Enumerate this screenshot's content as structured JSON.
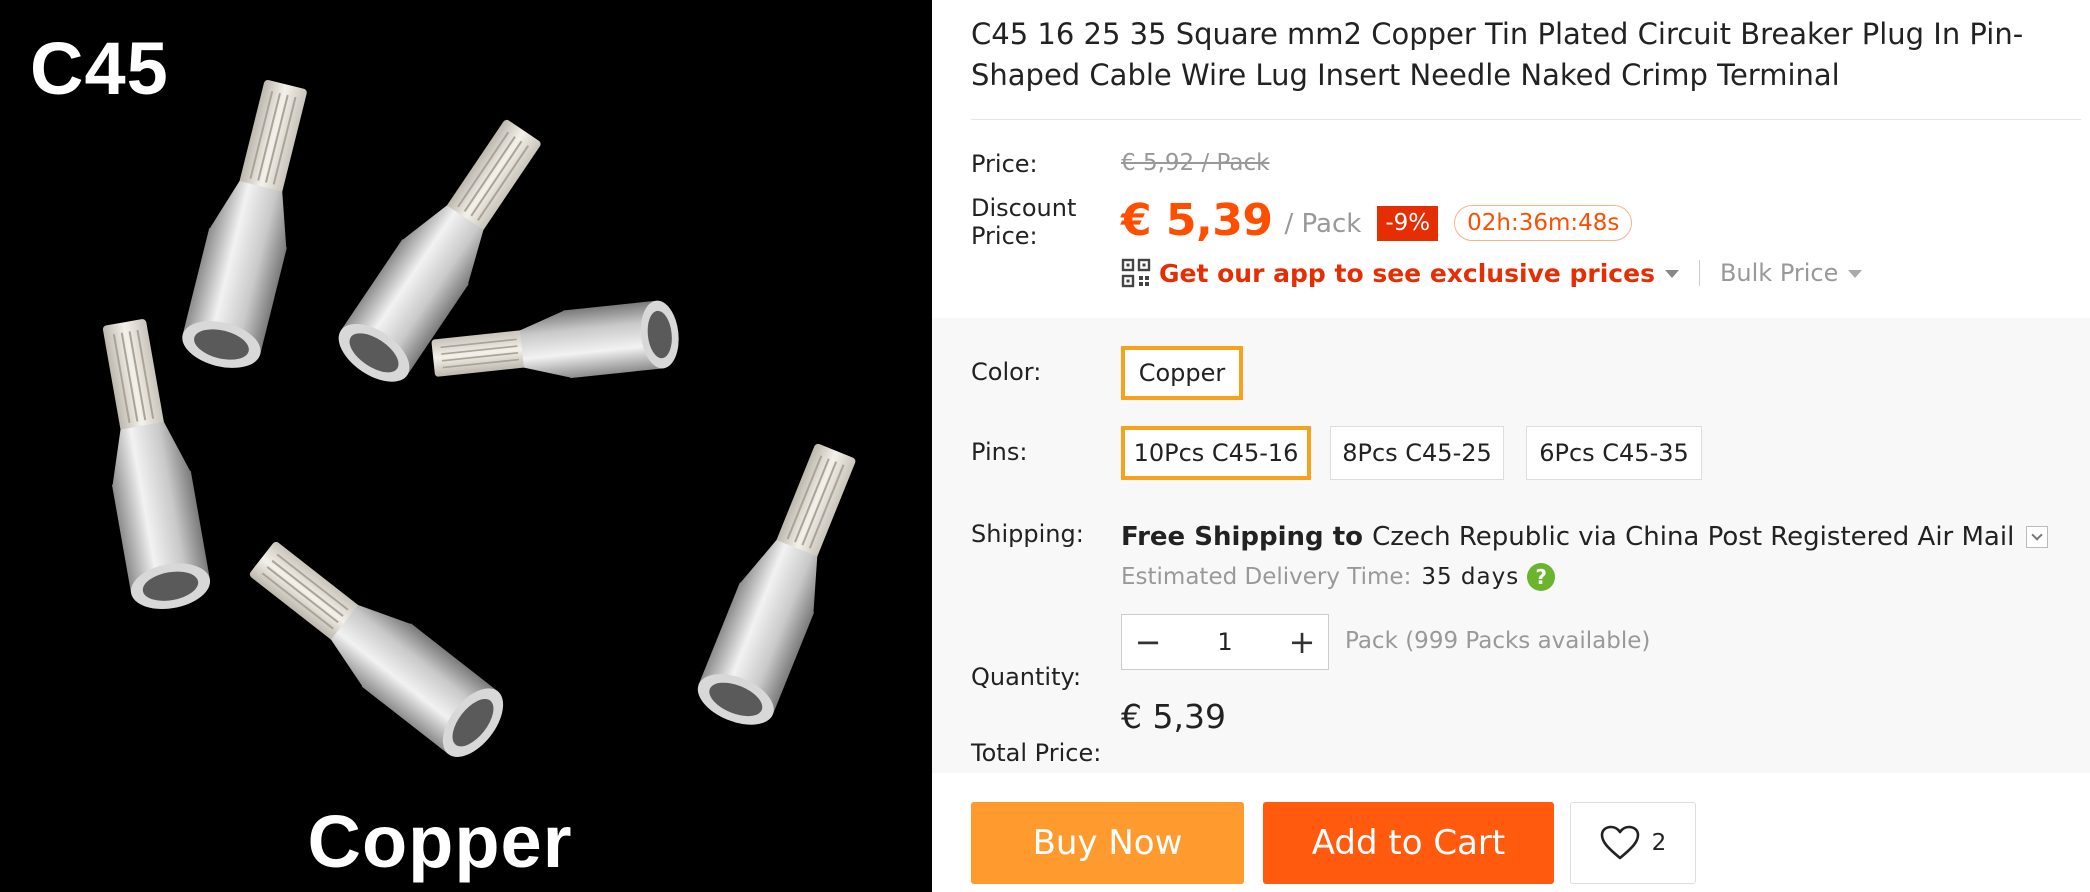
{
  "image": {
    "caption_top": "C45",
    "caption_bottom": "Copper"
  },
  "product": {
    "title": "C45 16 25 35 Square mm2 Copper Tin Plated Circuit Breaker Plug In Pin-Shaped Cable Wire Lug Insert Needle Naked Crimp Terminal"
  },
  "price": {
    "label": "Price:",
    "original": "€ 5,92 / Pack",
    "discount_label": "Discount Price:",
    "current": "€ 5,39",
    "unit": "/ Pack",
    "discount_badge": "-9%",
    "countdown": "02h:36m:48s"
  },
  "promo": {
    "app_link": "Get our app to see exclusive prices",
    "bulk_price": "Bulk Price"
  },
  "options": {
    "color_label": "Color:",
    "colors": [
      "Copper"
    ],
    "selected_color": "Copper",
    "pins_label": "Pins:",
    "pins": [
      "10Pcs C45-16",
      "8Pcs C45-25",
      "6Pcs C45-35"
    ],
    "selected_pin": "10Pcs C45-16"
  },
  "shipping": {
    "label": "Shipping:",
    "free": "Free Shipping",
    "to": " to ",
    "destination": "Czech Republic via China Post Registered Air Mail",
    "eta_label": "Estimated Delivery Time:",
    "eta_value": "35 days"
  },
  "quantity": {
    "label": "Quantity:",
    "value": "1",
    "minus": "−",
    "plus": "+",
    "available": "Pack (999 Packs available)"
  },
  "total": {
    "label": "Total Price:",
    "value": "€ 5,39"
  },
  "actions": {
    "buy_now": "Buy Now",
    "add_to_cart": "Add to Cart",
    "wishlist_count": "2"
  },
  "colors": {
    "accent_orange": "#ff4e00",
    "buy_now_bg": "#ff9a2f",
    "add_to_cart_bg": "#ff5a0e",
    "discount_badge_bg": "#e62e04",
    "selected_border": "#f7a21d",
    "help_icon": "#6bb42d"
  },
  "icons": [
    "qr-code-icon",
    "caret-down-icon",
    "chevron-down-icon",
    "question-icon",
    "minus-icon",
    "plus-icon",
    "heart-icon"
  ]
}
